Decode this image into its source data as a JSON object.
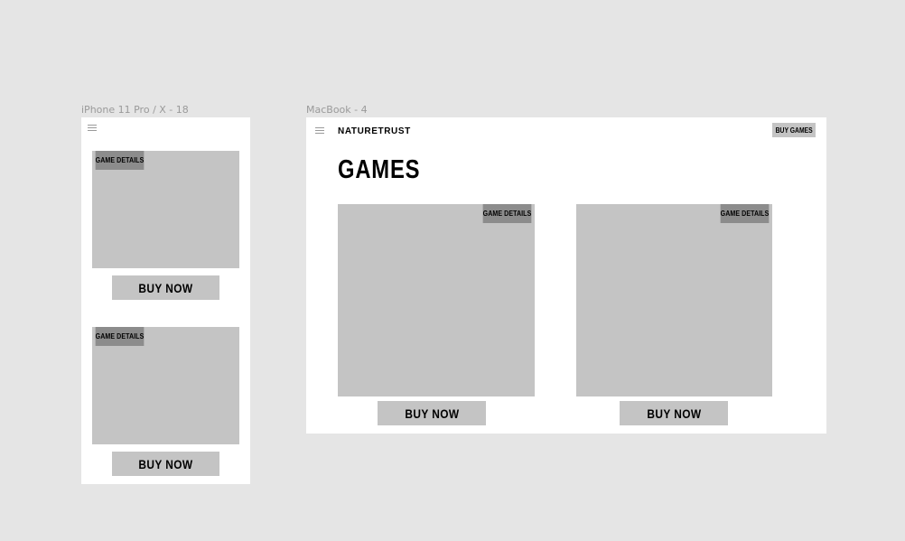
{
  "canvas": {
    "frames": [
      {
        "label": "iPhone 11 Pro / X - 18"
      },
      {
        "label": "MacBook - 4"
      }
    ]
  },
  "mobile": {
    "menu_icon": "hamburger-menu-icon",
    "cards": [
      {
        "details_label": "GAME DETAILS",
        "buy_label": "BUY NOW"
      },
      {
        "details_label": "GAME DETAILS",
        "buy_label": "BUY NOW"
      }
    ]
  },
  "desktop": {
    "menu_icon": "hamburger-menu-icon",
    "brand": "NATURETRUST",
    "nav_buy_label": "BUY GAMES",
    "title": "GAMES",
    "cards": [
      {
        "details_label": "GAME DETAILS",
        "buy_label": "BUY NOW"
      },
      {
        "details_label": "GAME DETAILS",
        "buy_label": "BUY NOW"
      }
    ]
  },
  "colors": {
    "canvas_bg": "#e5e5e5",
    "frame_bg": "#ffffff",
    "placeholder": "#c4c4c4",
    "details_bg": "#8c8c8c",
    "label_gray": "#9a9a9a"
  }
}
